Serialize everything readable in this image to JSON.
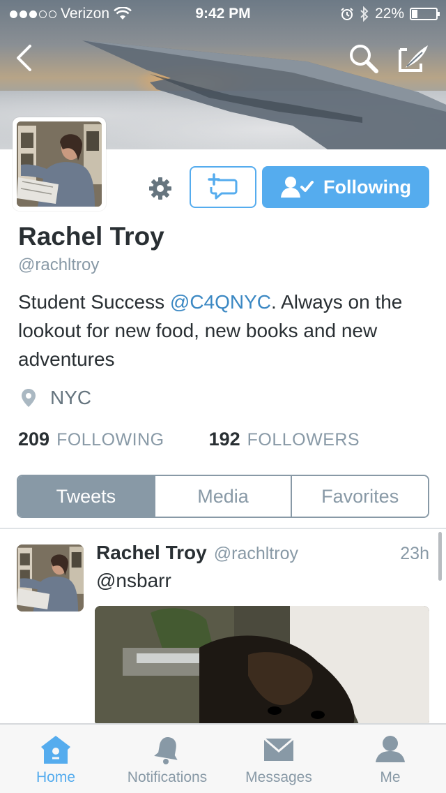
{
  "status_bar": {
    "carrier": "Verizon",
    "time": "9:42 PM",
    "battery": "22%",
    "battery_level": 0.22
  },
  "profile": {
    "name": "Rachel Troy",
    "handle": "@rachltroy",
    "bio_prefix": "Student Success ",
    "bio_mention": "@C4QNYC",
    "bio_suffix": ". Always on the lookout for new food, new books and new adventures",
    "location": "NYC",
    "following_count": "209",
    "following_label": "FOLLOWING",
    "followers_count": "192",
    "followers_label": "FOLLOWERS"
  },
  "actions": {
    "follow_label": "Following"
  },
  "tabs": [
    {
      "label": "Tweets",
      "active": true
    },
    {
      "label": "Media",
      "active": false
    },
    {
      "label": "Favorites",
      "active": false
    }
  ],
  "tweet": {
    "name": "Rachel Troy",
    "handle": "@rachltroy",
    "time": "23h",
    "text": "@nsbarr"
  },
  "tab_bar": [
    {
      "label": "Home",
      "icon": "home-icon",
      "active": true
    },
    {
      "label": "Notifications",
      "icon": "bell-icon",
      "active": false
    },
    {
      "label": "Messages",
      "icon": "envelope-icon",
      "active": false
    },
    {
      "label": "Me",
      "icon": "person-icon",
      "active": false
    }
  ],
  "colors": {
    "accent": "#55acee",
    "muted": "#8899a6",
    "link": "#3b88c3",
    "text": "#292f33"
  }
}
